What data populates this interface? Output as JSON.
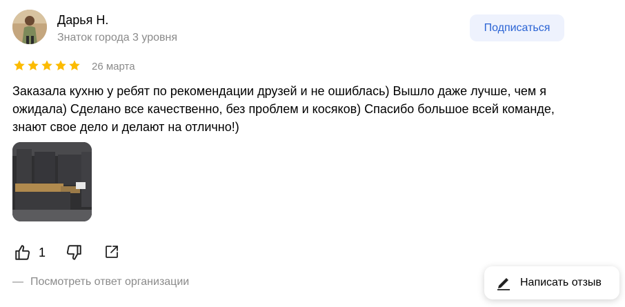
{
  "author": {
    "name": "Дарья Н.",
    "level": "Знаток города 3 уровня"
  },
  "subscribe_label": "Подписаться",
  "review": {
    "rating": 5,
    "rating_max": 5,
    "date": "26 марта",
    "text": "Заказала кухню у ребят по рекомендации друзей и не ошиблась) Вышло даже лучше, чем я ожидала) Сделано все качественно, без проблем и косяков) Спасибо большое всей команде, знают свое дело и делают на отлично!)"
  },
  "reactions": {
    "likes": "1",
    "like_icon": "thumbs-up-icon",
    "dislike_icon": "thumbs-down-icon",
    "share_icon": "share-icon"
  },
  "org_reply": {
    "dash": "—",
    "label": "Посмотреть ответ организации"
  },
  "write_review": {
    "label": "Написать отзыв",
    "icon": "pencil-icon"
  },
  "colors": {
    "accent": "#2a63d4",
    "star": "#fcbb00",
    "muted": "#8a8a8a"
  }
}
